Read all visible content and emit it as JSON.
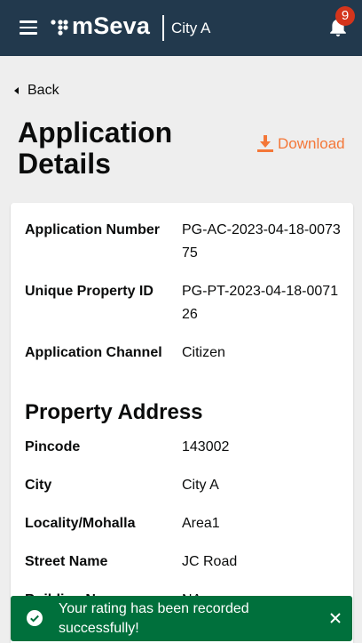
{
  "header": {
    "logo_text": "mSeva",
    "city": "City A",
    "notification_count": "9"
  },
  "back": {
    "label": "Back"
  },
  "page": {
    "title": "Application Details",
    "download_label": "Download"
  },
  "details": [
    {
      "label": "Application Number",
      "value": "PG-AC-2023-04-18-007375"
    },
    {
      "label": "Unique Property ID",
      "value": "PG-PT-2023-04-18-007126"
    },
    {
      "label": "Application Channel",
      "value": "Citizen"
    }
  ],
  "property_address": {
    "title": "Property Address",
    "rows": [
      {
        "label": "Pincode",
        "value": "143002"
      },
      {
        "label": "City",
        "value": "City A"
      },
      {
        "label": "Locality/Mohalla",
        "value": "Area1"
      },
      {
        "label": "Street Name",
        "value": "JC Road"
      },
      {
        "label": "Building Name",
        "value": "NA"
      }
    ]
  },
  "toast": {
    "message": "Your rating has been recorded successfully!"
  },
  "colors": {
    "header_bg": "#22394d",
    "accent": "#f47738",
    "success": "#00703c",
    "badge": "#d4351c"
  }
}
